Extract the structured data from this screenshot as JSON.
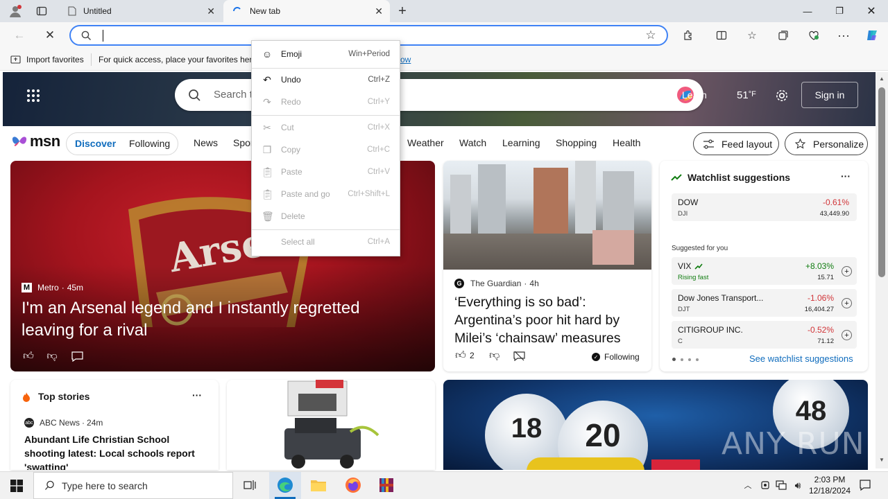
{
  "browser": {
    "tabs": [
      {
        "label": "Untitled"
      },
      {
        "label": "New tab"
      }
    ],
    "new_tab_label": "+",
    "address": {
      "value": "",
      "placeholder": ""
    },
    "favorites": {
      "import_label": "Import favorites",
      "hint": "For quick access, place your favorites here",
      "link": "ow"
    }
  },
  "context_menu": {
    "items": [
      {
        "label": "Emoji",
        "shortcut": "Win+Period",
        "icon": "emoji-icon",
        "disabled": false
      },
      {
        "label": "Undo",
        "shortcut": "Ctrl+Z",
        "icon": "undo-icon",
        "disabled": false
      },
      {
        "label": "Redo",
        "shortcut": "Ctrl+Y",
        "icon": "redo-icon",
        "disabled": true
      },
      {
        "label": "Cut",
        "shortcut": "Ctrl+X",
        "icon": "cut-icon",
        "disabled": true
      },
      {
        "label": "Copy",
        "shortcut": "Ctrl+C",
        "icon": "copy-icon",
        "disabled": true
      },
      {
        "label": "Paste",
        "shortcut": "Ctrl+V",
        "icon": "paste-icon",
        "disabled": true
      },
      {
        "label": "Paste and go",
        "shortcut": "Ctrl+Shift+L",
        "icon": "paste-go-icon",
        "disabled": true
      },
      {
        "label": "Delete",
        "shortcut": "",
        "icon": "delete-icon",
        "disabled": true
      },
      {
        "label": "Select all",
        "shortcut": "Ctrl+A",
        "icon": "",
        "disabled": true
      }
    ]
  },
  "msn": {
    "search_placeholder": "Search t",
    "learn": "Learn",
    "weather": "51",
    "weather_unit": "°F",
    "signin": "Sign in",
    "logo": "msn",
    "feed_tabs": [
      "Discover",
      "Following"
    ],
    "nav": [
      "News",
      "Spor",
      "Weather",
      "Watch",
      "Learning",
      "Shopping",
      "Health"
    ],
    "feed_layout": "Feed layout",
    "personalize": "Personalize"
  },
  "hero_story": {
    "source": "Metro",
    "age": "45m",
    "title": "I'm an Arsenal legend and I instantly regretted leaving for a rival",
    "shirt_text": "Arsenal"
  },
  "story2": {
    "source": "The Guardian",
    "age": "4h",
    "title": "‘Everything is so bad’: Argentina’s poor hit hard by Milei’s ‘chainsaw’ measures",
    "likes": "2",
    "following": "Following"
  },
  "watchlist": {
    "title": "Watchlist suggestions",
    "more": "···",
    "top": {
      "name": "DOW",
      "ticker": "DJI",
      "change": "-0.61%",
      "price": "43,449.90"
    },
    "suggested_label": "Suggested for you",
    "rows": [
      {
        "name": "VIX",
        "ticker": "Rising fast",
        "change": "+8.03%",
        "price": "15.71",
        "up": true
      },
      {
        "name": "Dow Jones Transport...",
        "ticker": "DJT",
        "change": "-1.06%",
        "price": "16,404.27",
        "up": false
      },
      {
        "name": "CITIGROUP INC.",
        "ticker": "C",
        "change": "-0.52%",
        "price": "71.12",
        "up": false
      }
    ],
    "see_more": "See watchlist suggestions"
  },
  "top_stories": {
    "title": "Top stories",
    "more": "···",
    "source": "ABC News",
    "age": "24m",
    "headline": "Abundant Life Christian School shooting latest: Local schools report 'swatting'"
  },
  "lottery": {
    "balls": [
      "18",
      "20",
      "48"
    ]
  },
  "watermark": "ANY RUN",
  "taskbar": {
    "search_placeholder": "Type here to search",
    "time": "2:03 PM",
    "date": "12/18/2024"
  },
  "colors": {
    "accent": "#0f6cbd",
    "down": "#d13438",
    "up": "#107c10",
    "menu_bg": "#ffffff",
    "omnibox_border": "#3f82f5"
  }
}
